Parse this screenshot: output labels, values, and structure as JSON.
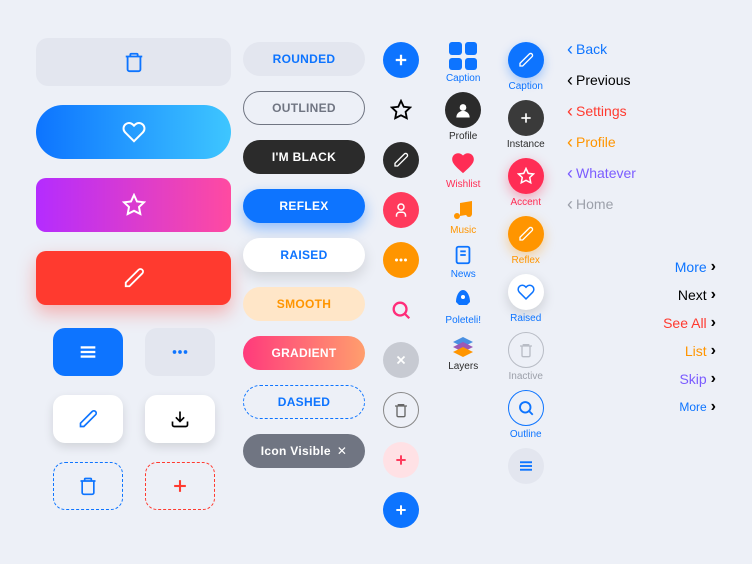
{
  "col1_buttons": [
    "trash",
    "heart",
    "star",
    "pencil"
  ],
  "pills": {
    "rounded": "ROUNDED",
    "outlined": "OUTLINED",
    "black": "I'M BLACK",
    "reflex": "REFLEX",
    "raised": "RAISED",
    "smooth": "SMOOTH",
    "gradient": "GRADIENT",
    "dashed": "DASHED",
    "icon_visible": "Icon Visible"
  },
  "col4_captions": {
    "caption": "Caption",
    "profile": "Profile",
    "wishlist": "Wishlist",
    "music": "Music",
    "news": "News",
    "poleteli": "Poleteli!",
    "layers": "Layers"
  },
  "col5_captions": {
    "caption": "Caption",
    "instance": "Instance",
    "accent": "Accent",
    "reflex": "Reflex",
    "raised": "Raised",
    "inactive": "Inactive",
    "outline": "Outline"
  },
  "nav_left": {
    "back": "Back",
    "previous": "Previous",
    "settings": "Settings",
    "profile": "Profile",
    "whatever": "Whatever",
    "home": "Home"
  },
  "nav_right": {
    "more": "More",
    "next": "Next",
    "see_all": "See All",
    "list": "List",
    "skip": "Skip",
    "more2": "More"
  }
}
